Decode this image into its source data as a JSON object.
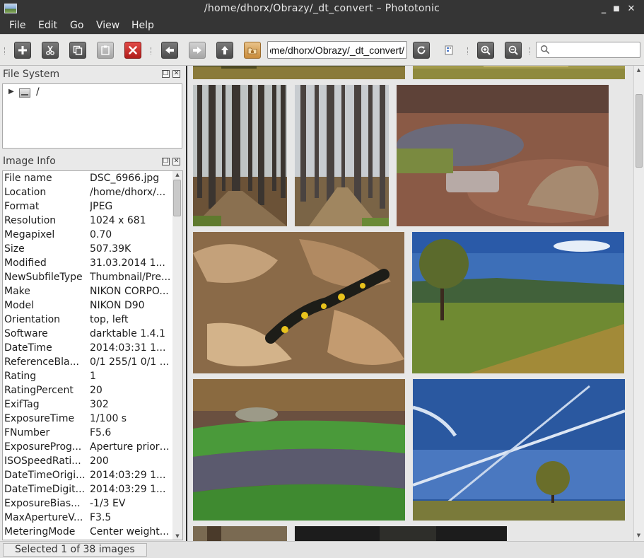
{
  "window": {
    "title": "/home/dhorx/Obrazy/_dt_convert – Phototonic",
    "min_glyph": "_",
    "max_glyph": "■",
    "close_glyph": "✕"
  },
  "menu": {
    "items": [
      "File",
      "Edit",
      "Go",
      "View",
      "Help"
    ]
  },
  "toolbar": {
    "path_value": "/home/dhorx/Obrazy/_dt_convert",
    "search_value": "",
    "icons": [
      "add-icon",
      "cut-icon",
      "copy-icon",
      "paste-icon",
      "delete-icon",
      "back-icon",
      "forward-icon",
      "up-icon",
      "home-folder-icon",
      "refresh-icon",
      "thumbnail-view-icon",
      "zoom-in-icon",
      "zoom-out-icon",
      "search-icon"
    ]
  },
  "file_system": {
    "title": "File System",
    "root_label": "/"
  },
  "image_info": {
    "title": "Image Info",
    "rows": [
      {
        "key": "File name",
        "value": "DSC_6966.jpg"
      },
      {
        "key": "Location",
        "value": "/home/dhorx/..."
      },
      {
        "key": "Format",
        "value": "JPEG"
      },
      {
        "key": "Resolution",
        "value": "1024 x 681"
      },
      {
        "key": "Megapixel",
        "value": "0.70"
      },
      {
        "key": "Size",
        "value": "507.39K"
      },
      {
        "key": "Modified",
        "value": "31.03.2014 1..."
      },
      {
        "key": "NewSubfileType",
        "value": "Thumbnail/Pre..."
      },
      {
        "key": "Make",
        "value": "NIKON CORPO..."
      },
      {
        "key": "Model",
        "value": "NIKON D90"
      },
      {
        "key": "Orientation",
        "value": "top, left"
      },
      {
        "key": "Software",
        "value": "darktable 1.4.1"
      },
      {
        "key": "DateTime",
        "value": "2014:03:31 1..."
      },
      {
        "key": "ReferenceBla...",
        "value": "0/1 255/1 0/1 ..."
      },
      {
        "key": "Rating",
        "value": "1"
      },
      {
        "key": "RatingPercent",
        "value": "20"
      },
      {
        "key": "ExifTag",
        "value": "302"
      },
      {
        "key": "ExposureTime",
        "value": "1/100 s"
      },
      {
        "key": "FNumber",
        "value": "F5.6"
      },
      {
        "key": "ExposureProg...",
        "value": "Aperture priority"
      },
      {
        "key": "ISOSpeedRati...",
        "value": "200"
      },
      {
        "key": "DateTimeOrigi...",
        "value": "2014:03:29 1..."
      },
      {
        "key": "DateTimeDigit...",
        "value": "2014:03:29 1..."
      },
      {
        "key": "ExposureBias...",
        "value": "-1/3 EV"
      },
      {
        "key": "MaxApertureV...",
        "value": "F3.5"
      },
      {
        "key": "MeteringMode",
        "value": "Center weight..."
      }
    ]
  },
  "thumbnails": {
    "subjects": [
      "partial-top-left",
      "partial-top-right",
      "forest-trunks-1",
      "forest-trunks-2",
      "forest-stream",
      "salamander-leaves",
      "meadow-tree",
      "mossy-stream",
      "blue-sky-tree",
      "partial-bottom-left",
      "partial-bottom-right"
    ]
  },
  "status": {
    "text": "Selected 1 of 38 images"
  },
  "colors": {
    "titlebar": "#353535",
    "toolbar": "#e8e8e7",
    "thumb_background": "#e7e7e7",
    "delete_red": "#c42522"
  }
}
